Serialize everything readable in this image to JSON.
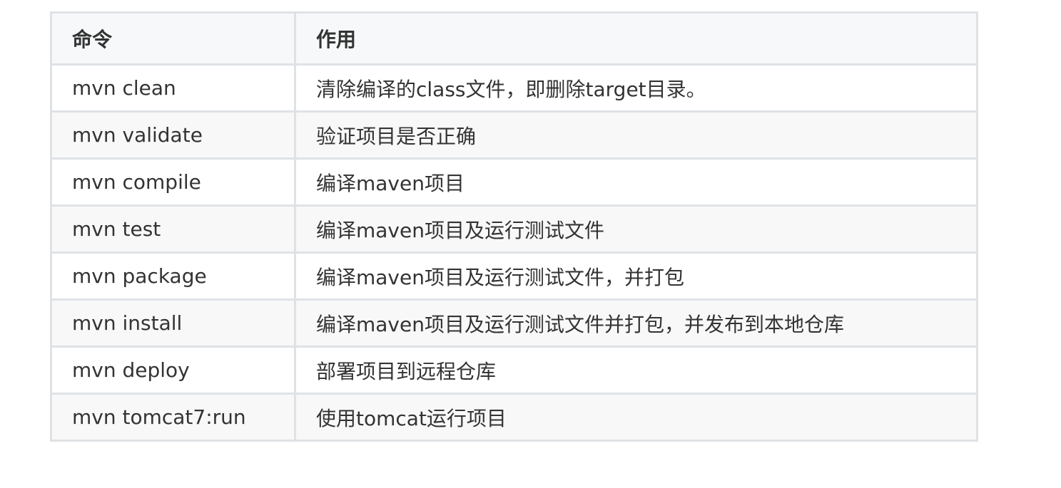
{
  "table": {
    "headers": [
      "命令",
      "作用"
    ],
    "rows": [
      {
        "command": "mvn clean",
        "description": "清除编译的class文件，即删除target目录。"
      },
      {
        "command": "mvn validate",
        "description": "验证项目是否正确"
      },
      {
        "command": "mvn compile",
        "description": "编译maven项目"
      },
      {
        "command": "mvn test",
        "description": "编译maven项目及运行测试文件"
      },
      {
        "command": "mvn package",
        "description": "编译maven项目及运行测试文件，并打包"
      },
      {
        "command": "mvn install",
        "description": "编译maven项目及运行测试文件并打包，并发布到本地仓库"
      },
      {
        "command": "mvn deploy",
        "description": "部署项目到远程仓库"
      },
      {
        "command": "mvn tomcat7:run",
        "description": "使用tomcat运行项目"
      }
    ]
  },
  "colors": {
    "border": "#dfe2e5",
    "header_bg": "#f6f8fa",
    "stripe_bg": "#f8f8f8",
    "text": "#333333"
  }
}
